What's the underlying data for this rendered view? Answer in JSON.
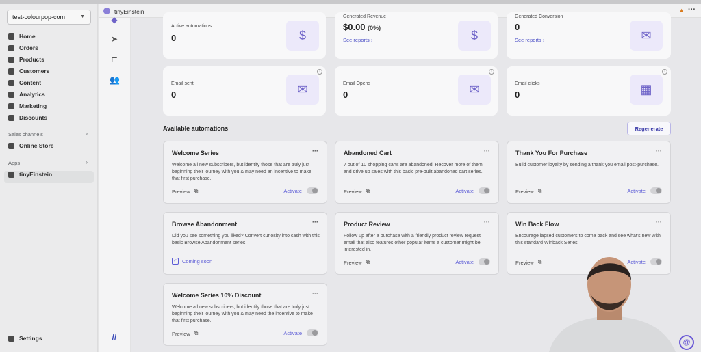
{
  "sidebar": {
    "store": "test-colourpop-com",
    "items": [
      {
        "label": "Home",
        "icon": "home-icon"
      },
      {
        "label": "Orders",
        "icon": "orders-icon"
      },
      {
        "label": "Products",
        "icon": "tag-icon"
      },
      {
        "label": "Customers",
        "icon": "person-icon"
      },
      {
        "label": "Content",
        "icon": "content-icon"
      },
      {
        "label": "Analytics",
        "icon": "chart-icon"
      },
      {
        "label": "Marketing",
        "icon": "marketing-icon"
      },
      {
        "label": "Discounts",
        "icon": "discount-icon"
      }
    ],
    "sales_channels_label": "Sales channels",
    "online_store": "Online Store",
    "apps_label": "Apps",
    "app_item": "tinyEinstein",
    "settings": "Settings"
  },
  "header": {
    "app_name": "tinyEinstein"
  },
  "stats": {
    "active_automations": {
      "label": "Active automations",
      "value": "0"
    },
    "generated_revenue": {
      "label": "Generated Revenue",
      "value": "$0.00",
      "pct": "(0%)",
      "link": "See reports"
    },
    "generated_conversion": {
      "label": "Generated Conversion",
      "value": "0",
      "link": "See reports"
    },
    "email_sent": {
      "label": "Email sent",
      "value": "0"
    },
    "email_opens": {
      "label": "Email Opens",
      "value": "0"
    },
    "email_clicks": {
      "label": "Email clicks",
      "value": "0"
    }
  },
  "automations_title": "Available automations",
  "regenerate": "Regenerate",
  "preview_label": "Preview",
  "activate_label": "Activate",
  "coming_soon": "Coming soon",
  "automations": [
    {
      "title": "Welcome Series",
      "desc": "Welcome all new subscribers, but identify those that are truly just beginning their journey with you & may need an incentive to make that first purchase."
    },
    {
      "title": "Abandoned Cart",
      "desc": "7 out of 10 shopping carts are abandoned. Recover more of them and drive up sales with this basic pre-built abandoned cart series."
    },
    {
      "title": "Thank You For Purchase",
      "desc": "Build customer loyalty by sending a thank you email post-purchase."
    },
    {
      "title": "Browse Abandonment",
      "desc": "Did you see something you liked? Convert curiosity into cash with this basic Browse Abandonment series."
    },
    {
      "title": "Product Review",
      "desc": "Follow up after a purchase with a friendly product review request email that also features other popular items a customer might be interested in."
    },
    {
      "title": "Win Back Flow",
      "desc": "Encourage lapsed customers to come back and see what's new with this standard Winback Series."
    },
    {
      "title": "Welcome Series 10% Discount",
      "desc": "Welcome all new subscribers, but identify those that are truly just beginning their journey with you & may need the incentive to make that first purchase."
    }
  ]
}
